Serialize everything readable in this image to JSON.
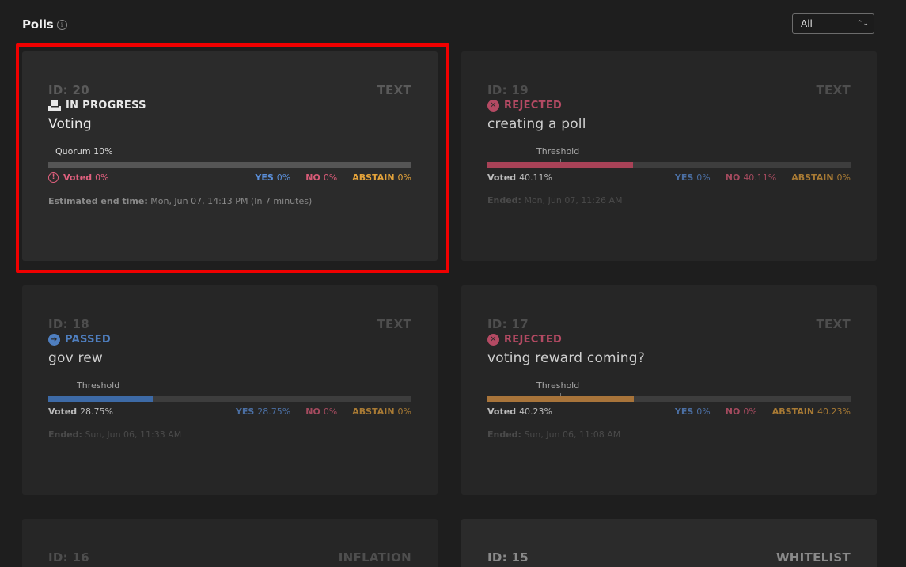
{
  "header": {
    "title": "Polls",
    "info_icon": "i"
  },
  "filter": {
    "selected": "All"
  },
  "polls": [
    {
      "id": "ID: 20",
      "type": "TEXT",
      "status": "IN PROGRESS",
      "status_icon": "voting-box-icon",
      "title": "Voting",
      "marker_label": "Quorum 10%",
      "marker_value": 0.1,
      "bar_fill": 0,
      "bar_color": "#555555",
      "voted_label": "Voted",
      "voted_value": "0%",
      "yes_label": "YES",
      "yes_value": "0%",
      "no_label": "NO",
      "no_value": "0%",
      "abstain_label": "ABSTAIN",
      "abstain_value": "0%",
      "end_label": "Estimated end time:",
      "end_value": "Mon, Jun 07, 14:13 PM (In 7 minutes)"
    },
    {
      "id": "ID: 19",
      "type": "TEXT",
      "status": "REJECTED",
      "status_icon": "x-circle-icon",
      "title": "creating a poll",
      "marker_label": "Threshold",
      "marker_value": 0.2,
      "bar_fill": 0.4011,
      "bar_color": "#a84257",
      "voted_label": "Voted",
      "voted_value": "40.11%",
      "yes_label": "YES",
      "yes_value": "0%",
      "no_label": "NO",
      "no_value": "40.11%",
      "abstain_label": "ABSTAIN",
      "abstain_value": "0%",
      "end_label": "Ended:",
      "end_value": "Mon, Jun 07, 11:26 AM"
    },
    {
      "id": "ID: 18",
      "type": "TEXT",
      "status": "PASSED",
      "status_icon": "arrow-circle-icon",
      "title": "gov rew",
      "marker_label": "Threshold",
      "marker_value": 0.14,
      "bar_fill": 0.2875,
      "bar_color": "#3d6aa6",
      "voted_label": "Voted",
      "voted_value": "28.75%",
      "yes_label": "YES",
      "yes_value": "28.75%",
      "no_label": "NO",
      "no_value": "0%",
      "abstain_label": "ABSTAIN",
      "abstain_value": "0%",
      "end_label": "Ended:",
      "end_value": "Sun, Jun 06, 11:33 AM"
    },
    {
      "id": "ID: 17",
      "type": "TEXT",
      "status": "REJECTED",
      "status_icon": "x-circle-icon",
      "title": "voting reward coming?",
      "marker_label": "Threshold",
      "marker_value": 0.2,
      "bar_fill": 0.4023,
      "bar_color": "#a8743a",
      "voted_label": "Voted",
      "voted_value": "40.23%",
      "yes_label": "YES",
      "yes_value": "0%",
      "no_label": "NO",
      "no_value": "0%",
      "abstain_label": "ABSTAIN",
      "abstain_value": "40.23%",
      "end_label": "Ended:",
      "end_value": "Sun, Jun 06, 11:08 AM"
    }
  ],
  "partial_cards": [
    {
      "id": "ID: 16",
      "type": "INFLATION"
    },
    {
      "id": "ID: 15",
      "type": "WHITELIST"
    }
  ],
  "colors": {
    "in_progress": "#e8e8e8",
    "rejected": "#b44a63",
    "passed": "#4f7fc0"
  }
}
